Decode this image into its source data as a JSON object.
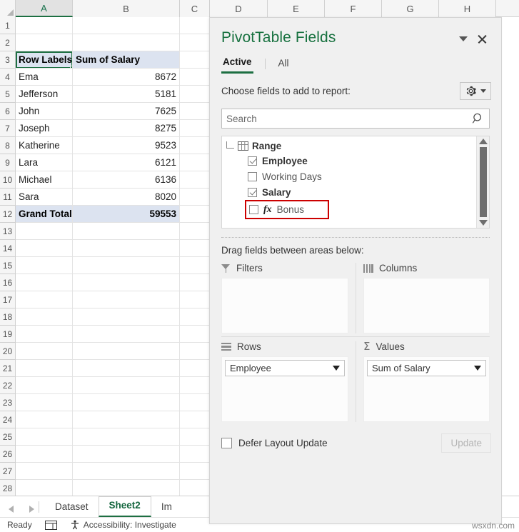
{
  "grid": {
    "columns": [
      "A",
      "B",
      "C",
      "D",
      "E",
      "F",
      "G",
      "H"
    ],
    "selected_column": "A",
    "rows": [
      "1",
      "2",
      "3",
      "4",
      "5",
      "6",
      "7",
      "8",
      "9",
      "10",
      "11",
      "12",
      "13",
      "14",
      "15",
      "16",
      "17",
      "18",
      "19",
      "20",
      "21",
      "22",
      "23",
      "24",
      "25",
      "26",
      "27",
      "28"
    ],
    "header_row_index": 3,
    "table": {
      "header": {
        "row_labels": "Row Labels",
        "value_header": "Sum of Salary"
      },
      "data": [
        {
          "name": "Ema",
          "value": "8672"
        },
        {
          "name": "Jefferson",
          "value": "5181"
        },
        {
          "name": "John",
          "value": "7625"
        },
        {
          "name": "Joseph",
          "value": "8275"
        },
        {
          "name": "Katherine",
          "value": "9523"
        },
        {
          "name": "Lara",
          "value": "6121"
        },
        {
          "name": "Michael",
          "value": "6136"
        },
        {
          "name": "Sara",
          "value": "8020"
        }
      ],
      "total": {
        "label": "Grand Total",
        "value": "59553"
      }
    }
  },
  "sheet_tabs": {
    "tabs": [
      {
        "label": "Dataset",
        "active": false
      },
      {
        "label": "Sheet2",
        "active": true
      },
      {
        "label": "Im",
        "active": false
      }
    ]
  },
  "status_bar": {
    "state": "Ready",
    "accessibility": "Accessibility: Investigate"
  },
  "panel": {
    "title": "PivotTable Fields",
    "tabs": [
      {
        "label": "Active",
        "active": true
      },
      {
        "label": "All",
        "active": false
      }
    ],
    "choose_label": "Choose fields to add to report:",
    "search": {
      "value": "",
      "placeholder": "Search"
    },
    "field_list": {
      "root": "Range",
      "fields": [
        {
          "label": "Employee",
          "checked": true,
          "bold": true,
          "calculated": false,
          "highlighted": false
        },
        {
          "label": "Working Days",
          "checked": false,
          "bold": false,
          "calculated": false,
          "highlighted": false
        },
        {
          "label": "Salary",
          "checked": true,
          "bold": true,
          "calculated": false,
          "highlighted": false
        },
        {
          "label": "Bonus",
          "checked": false,
          "bold": false,
          "calculated": true,
          "highlighted": true
        }
      ]
    },
    "drag_label": "Drag fields between areas below:",
    "areas": {
      "filters": {
        "title": "Filters",
        "items": []
      },
      "columns": {
        "title": "Columns",
        "items": []
      },
      "rows": {
        "title": "Rows",
        "items": [
          "Employee"
        ]
      },
      "values": {
        "title": "Values",
        "items": [
          "Sum of Salary"
        ]
      }
    },
    "defer_label": "Defer Layout Update",
    "defer_checked": false,
    "update_label": "Update"
  },
  "watermark": "wsxdn.com",
  "colors": {
    "accent_green": "#17713f",
    "header_fill": "#dce3f0",
    "highlight_red": "#cc0000"
  }
}
